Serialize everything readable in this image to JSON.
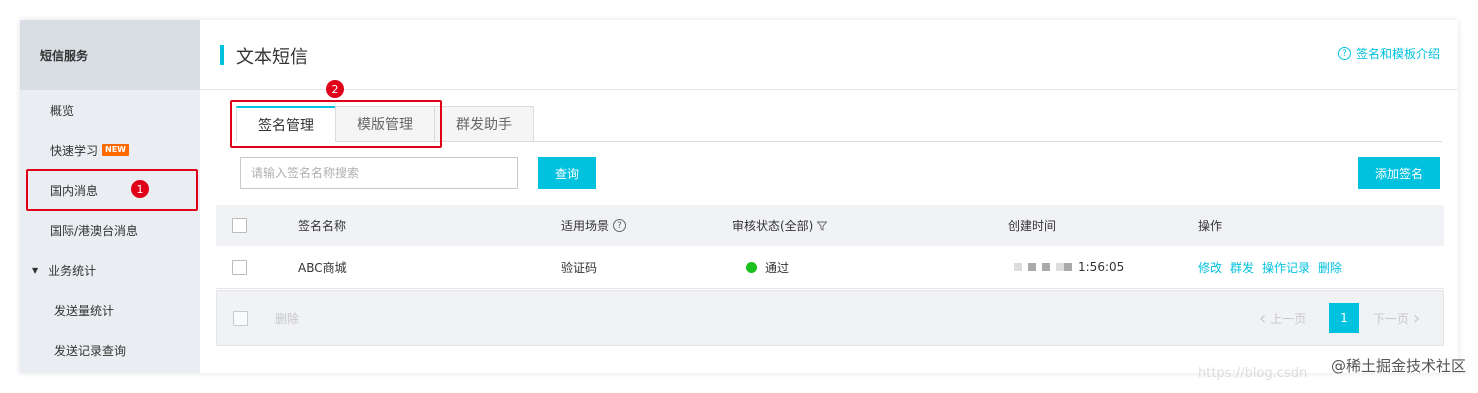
{
  "sidebar": {
    "header": "短信服务",
    "items": [
      {
        "label": "概览"
      },
      {
        "label": "快速学习",
        "badge": "NEW"
      },
      {
        "label": "国内消息"
      },
      {
        "label": "国际/港澳台消息"
      },
      {
        "label": "业务统计"
      },
      {
        "label": "发送量统计"
      },
      {
        "label": "发送记录查询"
      }
    ]
  },
  "annotations": {
    "badge1": "1",
    "badge2": "2"
  },
  "header": {
    "title": "文本短信",
    "help_link": "签名和模板介绍"
  },
  "tabs": [
    {
      "label": "签名管理",
      "active": true
    },
    {
      "label": "模版管理",
      "active": false
    },
    {
      "label": "群发助手",
      "active": false
    }
  ],
  "search": {
    "placeholder": "请输入签名名称搜索",
    "query_button": "查询"
  },
  "add_button": "添加签名",
  "table": {
    "columns": [
      "签名名称",
      "适用场景",
      "审核状态(全部)",
      "创建时间",
      "操作"
    ],
    "rows": [
      {
        "name": "ABC商城",
        "scene": "验证码",
        "status": "通过",
        "time_suffix": "1:56:05",
        "actions": [
          "修改",
          "群发",
          "操作记录",
          "删除"
        ]
      }
    ],
    "footer_delete": "删除"
  },
  "pagination": {
    "prev": "上一页",
    "page": "1",
    "next": "下一页"
  },
  "watermark": "@稀土掘金技术社区",
  "watermark_url": "https://blog.csdn",
  "colors": {
    "accent": "#00c1de",
    "annotation_red": "#e0001a",
    "status_green": "#1dc11d"
  }
}
